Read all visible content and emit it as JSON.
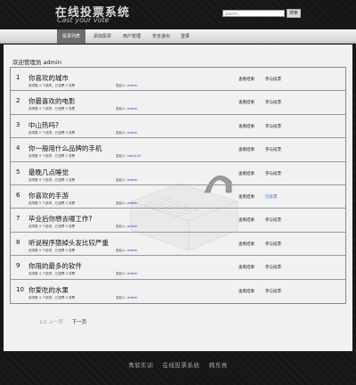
{
  "header": {
    "title": "在线投票系统",
    "subtitle": "Cast your vote",
    "search_placeholder": "Search...",
    "search_button": "搜索"
  },
  "nav": {
    "items": [
      {
        "label": "投票列表",
        "active": true
      },
      {
        "label": "添加投票",
        "active": false
      },
      {
        "label": "用户管理",
        "active": false
      },
      {
        "label": "安全退出",
        "active": false
      },
      {
        "label": "登录",
        "active": false
      }
    ]
  },
  "welcome": {
    "label": "欢迎管理员",
    "user": "admin"
  },
  "polls": [
    {
      "num": "1",
      "title": "你喜欢的城市",
      "meta": "选项数 4 个选项，已投票 0 张票",
      "initiator_label": "发起人:",
      "initiator": "admin",
      "view": "查看结果",
      "vote": "参与投票"
    },
    {
      "num": "2",
      "title": "你最喜欢的电影",
      "meta": "选项数 4 个选项，已投票 0 张票",
      "initiator_label": "发起人:",
      "initiator": "admin",
      "view": "查看结果",
      "vote": "参与投票"
    },
    {
      "num": "3",
      "title": "中山热吗?",
      "meta": "选项数 2 个选项，已投票 0 张票",
      "initiator_label": "发起人:",
      "initiator": "admin",
      "view": "查看结果",
      "vote": "参与投票"
    },
    {
      "num": "4",
      "title": "你一般用什么品牌的手机",
      "meta": "选项数 4 个选项，已投票 2 张票",
      "initiator_label": "发起人:",
      "initiator": "hsky123",
      "view": "查看结果",
      "vote": "参与投票"
    },
    {
      "num": "5",
      "title": "最晚几点睡觉",
      "meta": "选项数 4 个选项，已投票 0 张票",
      "initiator_label": "发起人:",
      "initiator": "admin",
      "view": "查看结果",
      "vote": "参与投票"
    },
    {
      "num": "6",
      "title": "你喜欢的手游",
      "meta": "选项数 5 个选项，已投票 0 张票",
      "initiator_label": "发起人:",
      "initiator": "admin",
      "view": "查看结果",
      "vote": "已投票",
      "voted": true
    },
    {
      "num": "7",
      "title": "毕业后你想去哪工作?",
      "meta": "选项数 4 个选项，已投票 0 张票",
      "initiator_label": "发起人:",
      "initiator": "admin",
      "view": "查看结果",
      "vote": "参与投票"
    },
    {
      "num": "8",
      "title": "听说程序猿掉头发比较严重",
      "meta": "选项数 4 个选项，已投票 0 张票",
      "initiator_label": "发起人:",
      "initiator": "admin",
      "view": "查看结果",
      "vote": "参与投票"
    },
    {
      "num": "9",
      "title": "你用的最多的软件",
      "meta": "选项数 4 个选项，已投票 0 张票",
      "initiator_label": "发起人:",
      "initiator": "admin",
      "view": "查看结果",
      "vote": "参与投票"
    },
    {
      "num": "10",
      "title": "你爱吃的水果",
      "meta": "选项数 4 个选项，已投票 0 张票",
      "initiator_label": "发起人:",
      "initiator": "admin",
      "view": "查看结果",
      "vote": "参与投票"
    }
  ],
  "pager": {
    "pages": "1/2",
    "prev": "上一页",
    "next": "下一页"
  },
  "footer": {
    "text": "青软实训    在线投票系统    韩东亮"
  },
  "colors": {
    "nav_active": "#6d6d6d",
    "link_blue": "#2040c0",
    "voted": "#3a6fb0"
  }
}
